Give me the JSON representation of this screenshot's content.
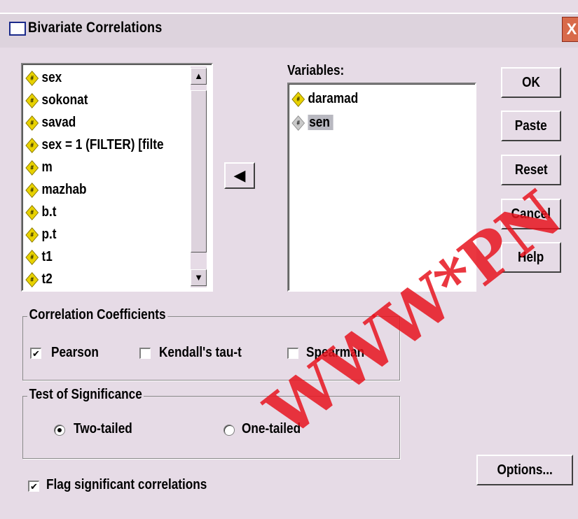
{
  "window": {
    "title": "Bivariate Correlations",
    "close_glyph": "X"
  },
  "source_list": {
    "items": [
      {
        "label": "sex"
      },
      {
        "label": "sokonat"
      },
      {
        "label": "savad"
      },
      {
        "label": "sex = 1 (FILTER) [filte"
      },
      {
        "label": "m"
      },
      {
        "label": "mazhab"
      },
      {
        "label": "b.t"
      },
      {
        "label": "p.t"
      },
      {
        "label": "t1"
      },
      {
        "label": "t2"
      }
    ],
    "scroll_up": "▲",
    "scroll_down": "▼"
  },
  "move_button": {
    "glyph": "◀",
    "icon": "arrow-left-icon"
  },
  "variables": {
    "label": "Variables:",
    "items": [
      {
        "label": "daramad",
        "selected": false
      },
      {
        "label": "sen",
        "selected": true
      }
    ]
  },
  "buttons": {
    "ok": "OK",
    "paste": "Paste",
    "reset": "Reset",
    "cancel": "Cancel",
    "help": "Help",
    "options": "Options..."
  },
  "correlation": {
    "title": "Correlation Coefficients",
    "pearson": {
      "label": "Pearson",
      "checked": true
    },
    "kendall": {
      "label": "Kendall's tau-b",
      "visible_text": "Kendall's tau-t",
      "checked": false
    },
    "spearman": {
      "label": "Spearman",
      "checked": false
    }
  },
  "significance": {
    "title": "Test of Significance",
    "two_tailed": {
      "label": "Two-tailed",
      "selected": true
    },
    "one_tailed": {
      "label": "One-tailed",
      "selected": false
    }
  },
  "flag": {
    "label": "Flag significant correlations",
    "checked": true
  },
  "check_glyph": "✔",
  "watermark": "WWW*PN",
  "colors": {
    "background": "#0a1a7a",
    "dialog": "#e6dbe6",
    "watermark": "#e6141e"
  }
}
